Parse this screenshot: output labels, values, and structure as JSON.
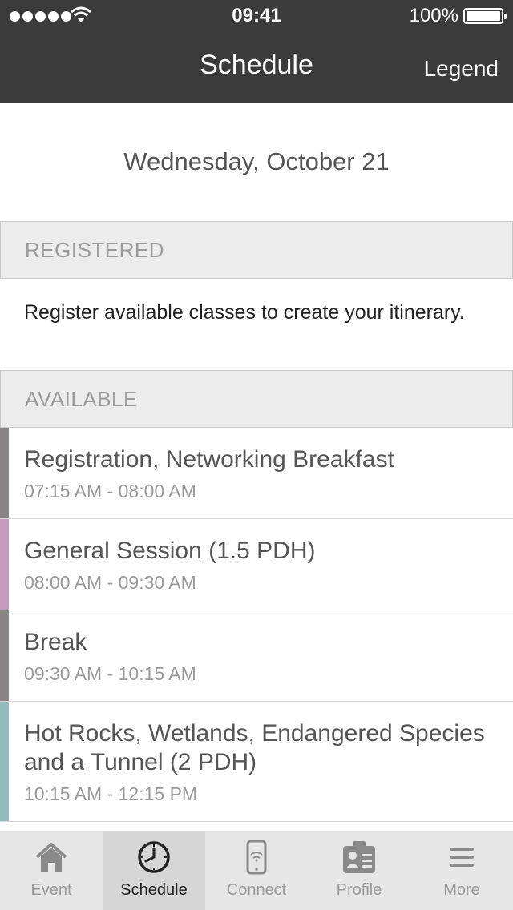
{
  "status": {
    "time": "09:41",
    "battery": "100%"
  },
  "nav": {
    "title": "Schedule",
    "legend": "Legend"
  },
  "date": "Wednesday, October 21",
  "registered": {
    "header": "REGISTERED",
    "note": "Register available classes to create your itinerary."
  },
  "available": {
    "header": "AVAILABLE",
    "items": [
      {
        "title": "Registration, Networking Breakfast",
        "time": "07:15 AM - 08:00 AM",
        "color": "#8a8584"
      },
      {
        "title": "General Session (1.5 PDH)",
        "time": "08:00 AM - 09:30 AM",
        "color": "#c49bbf"
      },
      {
        "title": "Break",
        "time": "09:30 AM - 10:15 AM",
        "color": "#8a8584"
      },
      {
        "title": "Hot Rocks, Wetlands, Endangered Species and a Tunnel (2 PDH)",
        "time": "10:15 AM - 12:15 PM",
        "color": "#93bcc0"
      }
    ]
  },
  "tabs": [
    {
      "label": "Event",
      "icon": "home-icon"
    },
    {
      "label": "Schedule",
      "icon": "clock-icon"
    },
    {
      "label": "Connect",
      "icon": "phone-icon"
    },
    {
      "label": "Profile",
      "icon": "id-card-icon"
    },
    {
      "label": "More",
      "icon": "menu-icon"
    }
  ],
  "active_tab": "Schedule"
}
